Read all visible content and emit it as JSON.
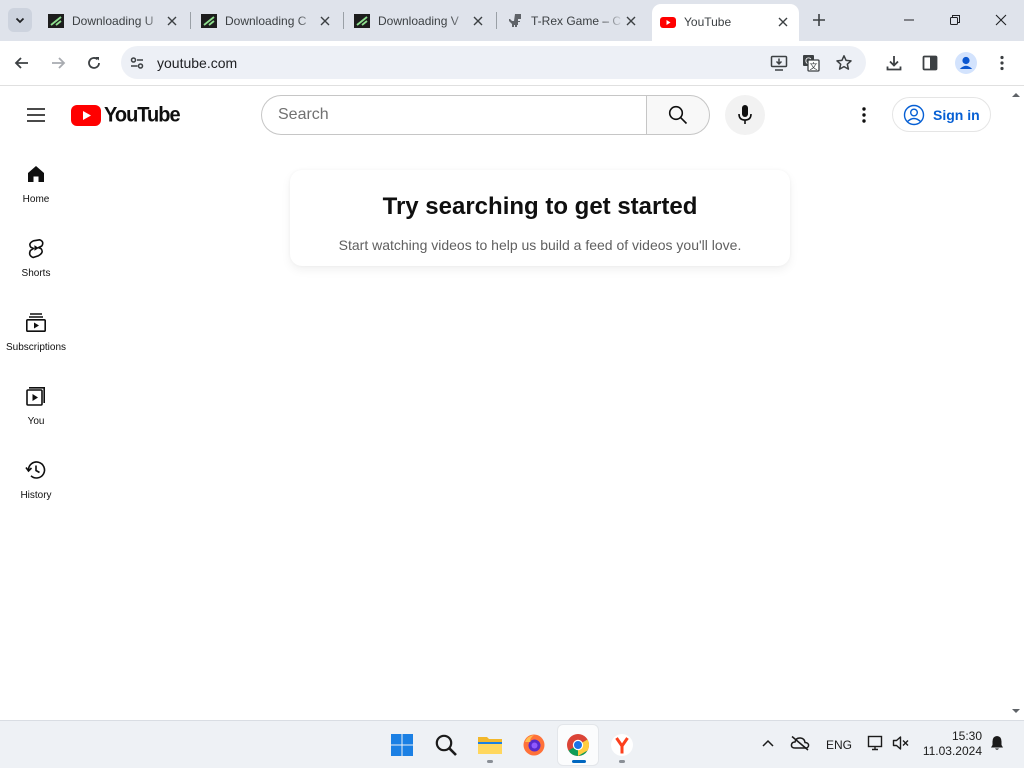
{
  "browser": {
    "tabs": [
      {
        "title": "Downloading U",
        "favicon": "download-page-icon",
        "active": false
      },
      {
        "title": "Downloading C",
        "favicon": "download-page-icon",
        "active": false
      },
      {
        "title": "Downloading V",
        "favicon": "download-page-icon",
        "active": false
      },
      {
        "title": "T-Rex Game – C",
        "favicon": "dino-icon",
        "active": false
      },
      {
        "title": "YouTube",
        "favicon": "youtube-icon",
        "active": true
      }
    ],
    "address_bar": {
      "url": "youtube.com"
    }
  },
  "youtube": {
    "logo_text": "YouTube",
    "search": {
      "placeholder": "Search"
    },
    "sign_in_label": "Sign in",
    "nav": [
      {
        "label": "Home",
        "icon": "home-icon"
      },
      {
        "label": "Shorts",
        "icon": "shorts-icon"
      },
      {
        "label": "Subscriptions",
        "icon": "subscriptions-icon"
      },
      {
        "label": "You",
        "icon": "you-icon"
      },
      {
        "label": "History",
        "icon": "history-icon"
      }
    ],
    "prompt": {
      "title": "Try searching to get started",
      "subtitle": "Start watching videos to help us build a feed of videos you'll love."
    },
    "colors": {
      "brand_red": "#ff0000",
      "link_blue": "#065fd4"
    }
  },
  "taskbar": {
    "apps": [
      "start-icon",
      "search-icon",
      "file-explorer-icon",
      "firefox-icon",
      "chrome-icon",
      "yandex-browser-icon"
    ],
    "active_app": "chrome-icon",
    "language": "ENG",
    "time": "15:30",
    "date": "11.03.2024"
  }
}
